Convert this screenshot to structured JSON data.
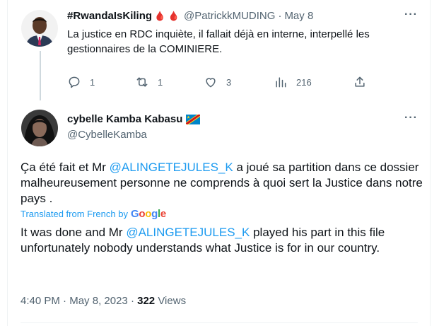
{
  "reply_tweet": {
    "display_name": "#RwandaIsKiling",
    "name_emoji": "🩸 🩸",
    "handle": "@PatrickkMUDING",
    "separator": "·",
    "date": "May 8",
    "text": "La justice en RDC inquiète, il fallait déjà en interne, interpellé les gestionnaires de la COMINIERE.",
    "actions": {
      "replies": "1",
      "retweets": "1",
      "likes": "3",
      "views": "216"
    }
  },
  "main_tweet": {
    "display_name": "cybelle Kamba Kabasu",
    "flag_name": "drc-flag-icon",
    "handle": "@CybelleKamba",
    "original_text": {
      "before": "Ça été fait et Mr ",
      "mention": "@ALINGETEJULES_K",
      "after": " a joué sa partition dans ce dossier malheureusement personne ne comprends à quoi sert la Justice dans notre pays ."
    },
    "translated_label": "Translated from French by",
    "translator": "Google",
    "translation": {
      "before": "It was done and Mr ",
      "mention": "@ALINGETEJULES_K",
      "after": " played his part in this file unfortunately nobody understands what Justice is for in our country."
    },
    "time": "4:40 PM",
    "separator": "·",
    "date": "May 8, 2023",
    "views_count": "322",
    "views_label": "Views"
  },
  "icons": [
    "reply-icon",
    "retweet-icon",
    "like-icon",
    "views-icon",
    "share-icon",
    "more-icon"
  ],
  "colors": {
    "accent": "#1d9bf0",
    "text": "#0f1419",
    "secondary": "#536471"
  }
}
